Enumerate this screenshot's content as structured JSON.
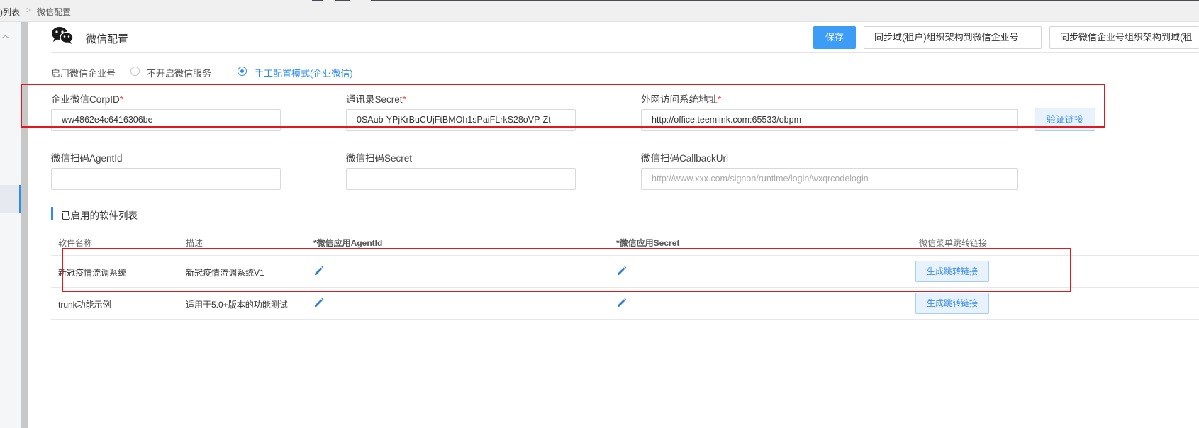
{
  "breadcrumb": {
    "parent": ")列表",
    "separator": ">",
    "current": "微信配置"
  },
  "header": {
    "title": "微信配置",
    "save_label": "保存",
    "sync_to_wechat_label": "同步域(租户)组织架构到微信企业号",
    "sync_from_wechat_label": "同步微信企业号组织架构到域(租"
  },
  "enable": {
    "label": "启用微信企业号",
    "options": [
      {
        "label": "不开启微信服务",
        "checked": false
      },
      {
        "label": "手工配置模式(企业微信)",
        "checked": true
      }
    ]
  },
  "fields": {
    "corp_id": {
      "label": "企业微信CorpID",
      "required": "*",
      "value": "ww4862e4c6416306be"
    },
    "contacts_secret": {
      "label": "通讯录Secret",
      "required": "*",
      "value": "0SAub-YPjKrBuCUjFtBMOh1sPaiFLrkS28oVP-Zt"
    },
    "external_url": {
      "label": "外网访问系统地址",
      "required": "*",
      "value": "http://office.teemlink.com:65533/obpm"
    },
    "verify_label": "验证链接",
    "scan_agent_id": {
      "label": "微信扫码AgentId",
      "value": ""
    },
    "scan_secret": {
      "label": "微信扫码Secret",
      "value": ""
    },
    "scan_callback": {
      "label": "微信扫码CallbackUrl",
      "placeholder": "http://www.xxx.com/signon/runtime/login/wxqrcodelogin"
    }
  },
  "software_section": {
    "title": "已启用的软件列表",
    "columns": [
      "软件名称",
      "描述",
      "*微信应用AgentId",
      "*微信应用Secret",
      "微信菜单跳转链接"
    ],
    "rows": [
      {
        "name": "新冠疫情流调系统",
        "description": "新冠疫情流调系统V1",
        "button": "生成跳转链接"
      },
      {
        "name": "trunk功能示例",
        "description": "适用于5.0+版本的功能测试",
        "button": "生成跳转链接"
      }
    ]
  },
  "colors": {
    "primary": "#3c9cf6",
    "annotation_red": "#e3181e",
    "required_red": "#e84a4a"
  },
  "icons": [
    "wechat-icon",
    "pencil-icon",
    "chevron-up-icon"
  ]
}
